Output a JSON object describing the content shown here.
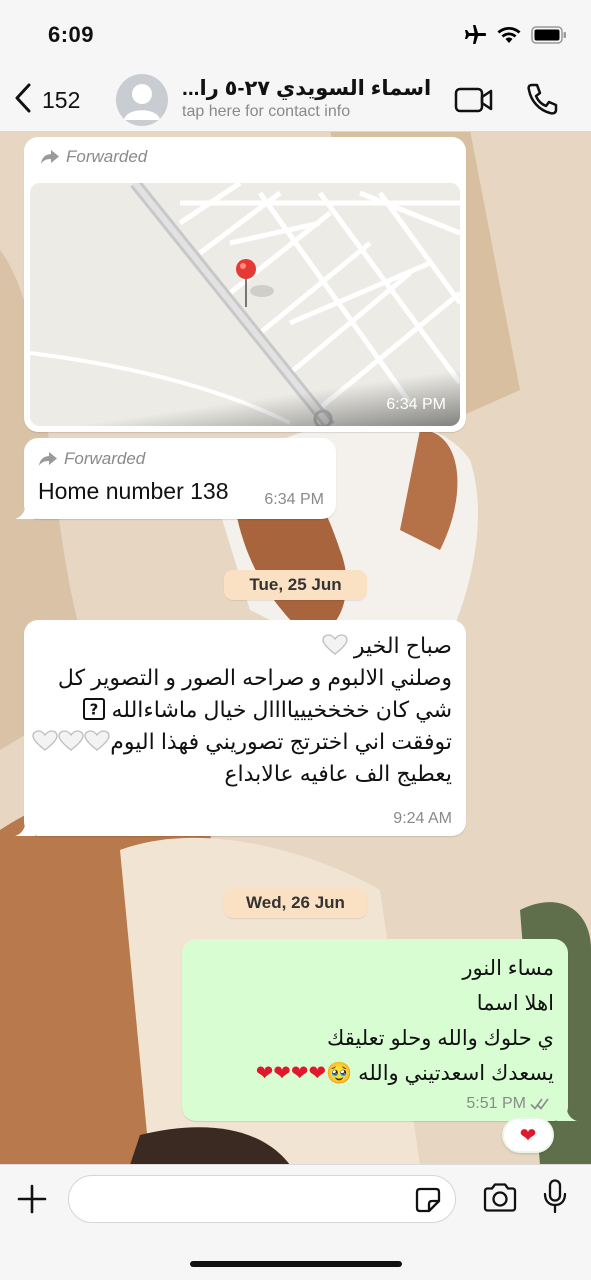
{
  "status_bar": {
    "time": "6:09"
  },
  "header": {
    "back_count": "152",
    "contact_name": "اسماء السويدي ٢٧-٥ را...",
    "contact_subtitle": "tap here for contact info"
  },
  "messages": {
    "map": {
      "forwarded_label": "Forwarded",
      "time": "6:34 PM"
    },
    "home": {
      "forwarded_label": "Forwarded",
      "text": "Home number 138",
      "time": "6:34 PM"
    },
    "date1": "Tue, 25 Jun",
    "arabic": {
      "lines": [
        "صباح الخير",
        "وصلني الالبوم و صراحه الصور و التصوير كل",
        "شي كان خخخخييياااال خيال ماشاءالله",
        "توفقت اني اخترتج تصوريني فهذا اليوم",
        "يعطيج الف عافيه عالابداع"
      ],
      "time": "9:24 AM"
    },
    "date2": "Wed, 26 Jun",
    "outgoing": {
      "lines": [
        "مساء النور",
        "اهلا اسما",
        "ي حلوك والله وحلو تعليقك",
        "يسعدك اسعدتيني والله"
      ],
      "emoji": "🥹",
      "hearts": "❤❤❤❤",
      "time": "5:51 PM",
      "reaction": "❤"
    }
  },
  "composer": {
    "placeholder": ""
  },
  "colors": {
    "outgoing_bubble": "#d9fdd3",
    "date_pill": "#fbe1c4",
    "map_pin": "#e53935",
    "heart": "#e0182d"
  },
  "icons": [
    "airplane-icon",
    "wifi-icon",
    "battery-icon",
    "chevron-left-icon",
    "avatar-icon",
    "video-call-icon",
    "phone-icon",
    "forward-arrow-icon",
    "map-pin-icon",
    "unknown-glyph-icon",
    "white-heart-icon",
    "double-check-icon",
    "plus-icon",
    "sticker-icon",
    "camera-icon",
    "mic-icon"
  ]
}
